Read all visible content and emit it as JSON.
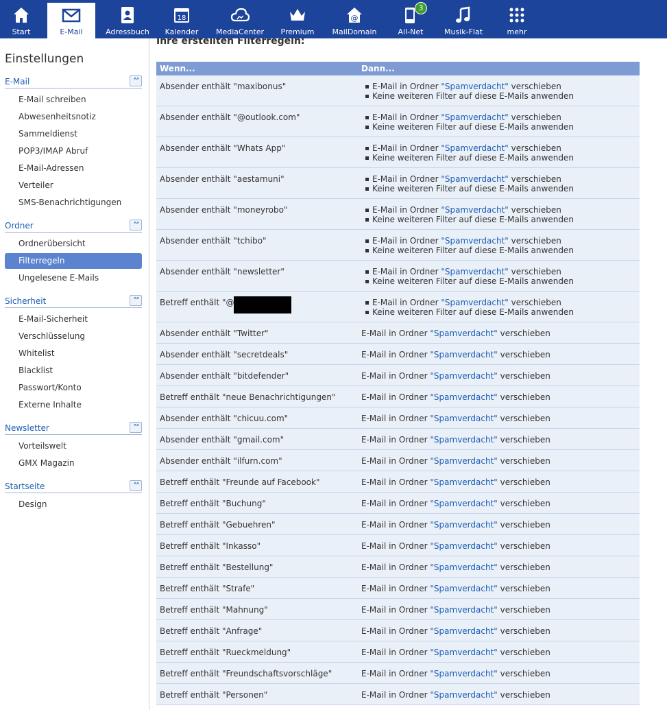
{
  "nav": [
    {
      "label": "Start",
      "icon": "home-icon"
    },
    {
      "label": "E-Mail",
      "icon": "envelope-icon"
    },
    {
      "label": "Adressbuch",
      "icon": "address-book-icon"
    },
    {
      "label": "Kalender",
      "icon": "calendar-icon",
      "icon_text": "18"
    },
    {
      "label": "MediaCenter",
      "icon": "cloud-icon"
    },
    {
      "label": "Premium",
      "icon": "crown-icon"
    },
    {
      "label": "MailDomain",
      "icon": "mail-domain-icon"
    },
    {
      "label": "All-Net",
      "icon": "phone-icon",
      "badge": "3"
    },
    {
      "label": "Musik-Flat",
      "icon": "music-note-icon"
    },
    {
      "label": "mehr",
      "icon": "grid-dots-icon"
    }
  ],
  "sidebar": {
    "title": "Einstellungen",
    "sections": [
      {
        "title": "E-Mail",
        "items": [
          "E-Mail schreiben",
          "Abwesenheitsnotiz",
          "Sammeldienst",
          "POP3/IMAP Abruf",
          "E-Mail-Adressen",
          "Verteiler",
          "SMS-Benachrichtigungen"
        ]
      },
      {
        "title": "Ordner",
        "items": [
          "Ordnerübersicht",
          "Filterregeln",
          "Ungelesene E-Mails"
        ]
      },
      {
        "title": "Sicherheit",
        "items": [
          "E-Mail-Sicherheit",
          "Verschlüsselung",
          "Whitelist",
          "Blacklist",
          "Passwort/Konto",
          "Externe Inhalte"
        ]
      },
      {
        "title": "Newsletter",
        "items": [
          "Vorteilswelt",
          "GMX Magazin"
        ]
      },
      {
        "title": "Startseite",
        "items": [
          "Design"
        ]
      }
    ],
    "active_item": "Filterregeln"
  },
  "main": {
    "heading": "Ihre erstellten Filterregeln:",
    "col_if": "Wenn...",
    "col_then": "Dann...",
    "action_prefix": "E-Mail in Ordner ",
    "folder_name": "\"Spamverdacht\"",
    "action_suffix": " verschieben",
    "stop_text": "Keine weiteren Filter auf diese E-Mails anwenden",
    "rules": [
      {
        "cond": "Absender enthält \"maxibonus\"",
        "stop": true
      },
      {
        "cond": "Absender enthält \"@outlook.com\"",
        "stop": true
      },
      {
        "cond": "Absender enthält \"Whats App\"",
        "stop": true
      },
      {
        "cond": "Absender enthält \"aestamuni\"",
        "stop": true
      },
      {
        "cond": "Absender enthält \"moneyrobo\"",
        "stop": true
      },
      {
        "cond": "Absender enthält \"tchibo\"",
        "stop": true
      },
      {
        "cond": "Absender enthält \"newsletter\"",
        "stop": true
      },
      {
        "cond": "Betreff enthält \"@",
        "stop": true,
        "redacted": true
      },
      {
        "cond": "Absender enthält \"Twitter\"",
        "stop": false
      },
      {
        "cond": "Absender enthält \"secretdeals\"",
        "stop": false
      },
      {
        "cond": "Absender enthält \"bitdefender\"",
        "stop": false
      },
      {
        "cond": "Betreff enthält \"neue Benachrichtigungen\"",
        "stop": false
      },
      {
        "cond": "Absender enthält \"chicuu.com\"",
        "stop": false
      },
      {
        "cond": "Absender enthält \"gmail.com\"",
        "stop": false
      },
      {
        "cond": "Absender enthält \"ilfurn.com\"",
        "stop": false
      },
      {
        "cond": "Betreff enthält \"Freunde auf Facebook\"",
        "stop": false
      },
      {
        "cond": "Betreff enthält \"Buchung\"",
        "stop": false
      },
      {
        "cond": "Betreff enthält \"Gebuehren\"",
        "stop": false
      },
      {
        "cond": "Betreff enthält \"Inkasso\"",
        "stop": false
      },
      {
        "cond": "Betreff enthält \"Bestellung\"",
        "stop": false
      },
      {
        "cond": "Betreff enthält \"Strafe\"",
        "stop": false
      },
      {
        "cond": "Betreff enthält \"Mahnung\"",
        "stop": false
      },
      {
        "cond": "Betreff enthält \"Anfrage\"",
        "stop": false
      },
      {
        "cond": "Betreff enthält \"Rueckmeldung\"",
        "stop": false
      },
      {
        "cond": "Betreff enthält \"Freundschaftsvorschläge\"",
        "stop": false
      },
      {
        "cond": "Betreff enthält \"Personen\"",
        "stop": false
      }
    ]
  },
  "colors": {
    "nav_bg": "#1c449b",
    "table_header": "#7e9bd3",
    "row_bg": "#eaf0f8",
    "link": "#1c5db4",
    "active_item": "#5b83cf",
    "badge": "#3c9e2e"
  }
}
